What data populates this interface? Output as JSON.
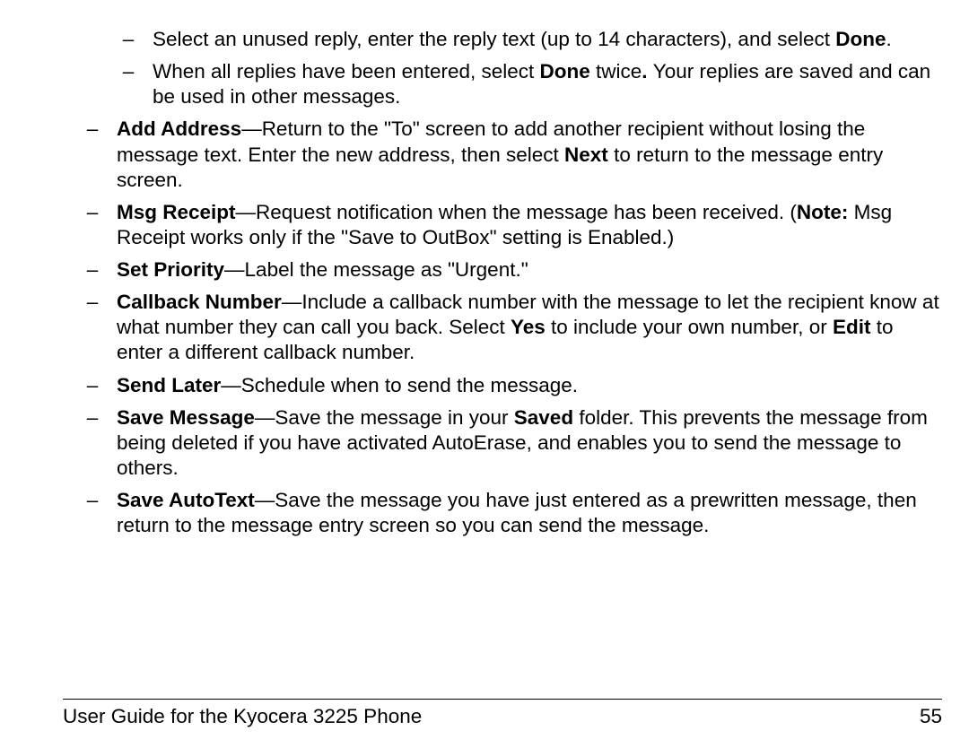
{
  "emdash": "—",
  "dash": "–",
  "sub_items": [
    {
      "pre": "Select an unused reply, enter the reply text (up to 14 characters), and select ",
      "bold_tail": "Done",
      "post_tail": "."
    },
    {
      "pre": "When all replies have been entered, select ",
      "bold_mid": "Done",
      "post": " twice",
      "bold_dot": ". ",
      "post2": "Your replies are saved and can be used in other messages."
    }
  ],
  "items": [
    {
      "bold": "Add Address",
      "text_before_next": "—Return to the \"To\" screen to add another recipient without losing the message text. Enter the new address, then select ",
      "bold2": "Next",
      "text_after": " to return to the message entry screen."
    },
    {
      "bold": "Msg Receipt",
      "text": "—Request notification when the message has been received. (",
      "bold2": "Note:",
      "text2": " Msg Receipt works only if the \"Save to OutBox\" setting is Enabled.)"
    },
    {
      "bold": "Set Priority",
      "text": "—Label the message as \"Urgent.\""
    },
    {
      "bold": "Callback Number",
      "text": "—Include a callback number with the message to let the recipient know at what number they can call you back. Select ",
      "bold2": "Yes",
      "text2": " to include your own number, or ",
      "bold3": "Edit",
      "text3": " to enter a different callback number."
    },
    {
      "bold": "Send Later",
      "text": "—Schedule when to send the message."
    },
    {
      "bold": "Save Message",
      "text": "—Save the message in your ",
      "bold2": "Saved",
      "text2": " folder. This prevents the message from being deleted if you have activated AutoErase, and enables you to send the message to others."
    },
    {
      "bold": "Save AutoText",
      "text": "—Save the message you have just entered as a prewritten message, then return to the message entry screen so you can send the message."
    }
  ],
  "footer": {
    "left": "User Guide for the Kyocera 3225 Phone",
    "right": "55"
  }
}
